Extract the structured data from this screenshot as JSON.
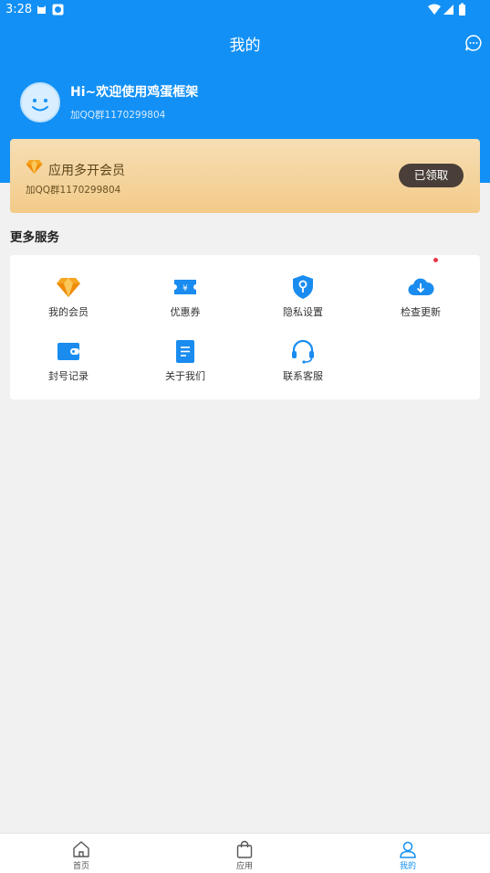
{
  "status_bar": {
    "time": "3:28"
  },
  "header": {
    "title": "我的",
    "welcome": "Hi~欢迎使用鸡蛋框架",
    "qq_group": "加QQ群1170299804"
  },
  "vip_card": {
    "title": "应用多开会员",
    "subtitle": "加QQ群1170299804",
    "button_label": "已领取"
  },
  "services": {
    "section_title": "更多服务",
    "items": [
      {
        "label": "我的会员",
        "icon": "diamond-icon"
      },
      {
        "label": "优惠券",
        "icon": "coupon-icon"
      },
      {
        "label": "隐私设置",
        "icon": "privacy-shield-icon"
      },
      {
        "label": "检查更新",
        "icon": "cloud-download-icon",
        "badge": true
      },
      {
        "label": "封号记录",
        "icon": "wallet-icon"
      },
      {
        "label": "关于我们",
        "icon": "document-icon"
      },
      {
        "label": "联系客服",
        "icon": "headset-icon"
      }
    ]
  },
  "tabbar": {
    "tabs": [
      {
        "label": "首页",
        "icon": "home-icon",
        "active": false
      },
      {
        "label": "应用",
        "icon": "bag-icon",
        "active": false
      },
      {
        "label": "我的",
        "icon": "user-icon",
        "active": true
      }
    ]
  },
  "colors": {
    "primary": "#1290f5",
    "vip_gold": "#f3cb8a",
    "button_dark": "#4a3f38",
    "badge_red": "#e8364a"
  }
}
